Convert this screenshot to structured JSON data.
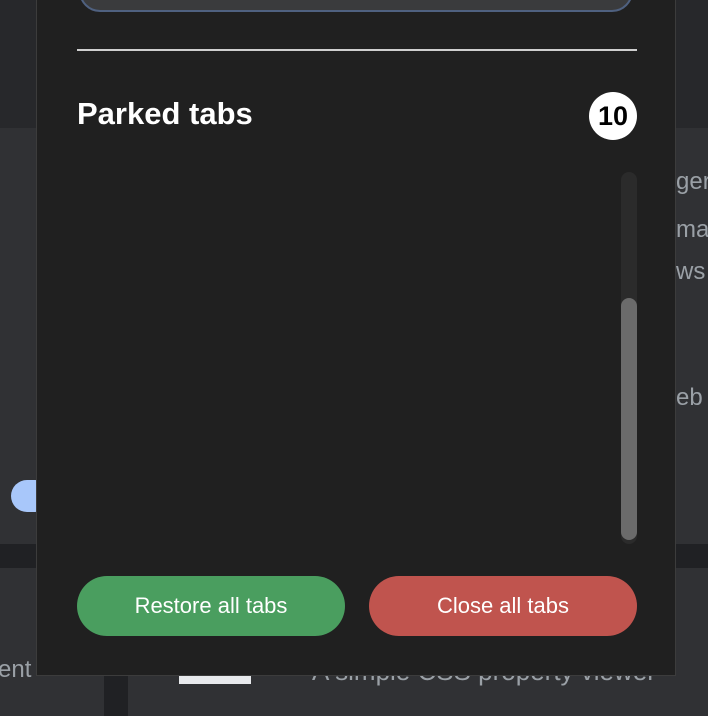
{
  "background": {
    "right_fragments": [
      "ger",
      "ma",
      "ws",
      "eb"
    ],
    "left_fragment": "ent",
    "bottom_text": "A simple CSS property viewer"
  },
  "popup": {
    "title": "Parked tabs",
    "count": "10",
    "restore_label": "Restore all tabs",
    "close_label": "Close all tabs"
  },
  "colors": {
    "restore": "#4a9e5f",
    "close": "#c0544e",
    "panel": "#202020"
  }
}
